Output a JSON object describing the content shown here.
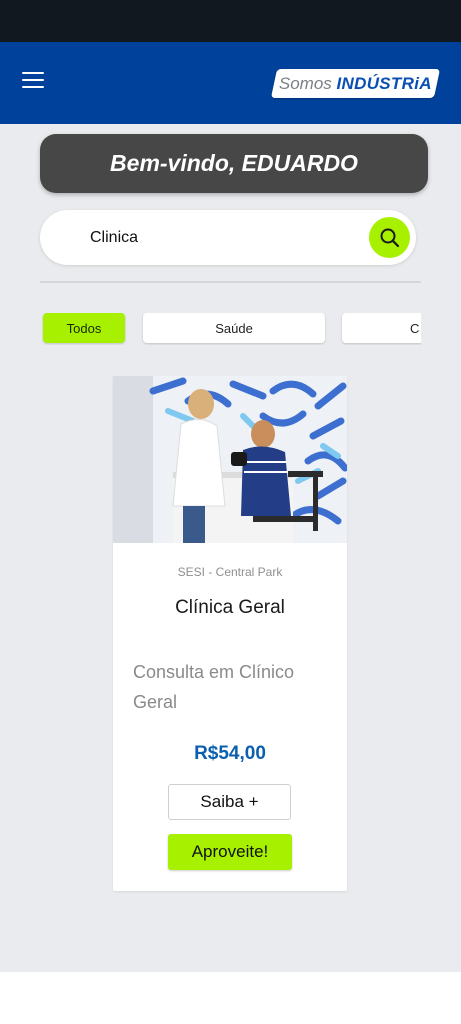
{
  "header": {
    "menu_icon": "hamburger-menu-icon",
    "logo": {
      "part1": "Somos ",
      "part2": "INDÚSTRiA"
    }
  },
  "welcome": {
    "text": "Bem-vindo, EDUARDO"
  },
  "search": {
    "value": "Clinica",
    "placeholder": "",
    "icon": "search-icon"
  },
  "filters": [
    {
      "label": "Todos",
      "active": true
    },
    {
      "label": "Saúde",
      "active": false
    },
    {
      "label": "C",
      "active": false
    }
  ],
  "card": {
    "image": "photo-nurse-measuring-blood-pressure",
    "location": "SESI - Central Park",
    "title": "Clínica Geral",
    "description": "Consulta em Clínico Geral",
    "price": "R$54,00",
    "more_button": "Saiba +",
    "cta_button": "Aproveite!"
  },
  "colors": {
    "header": "#00429b",
    "accent": "#a6f000",
    "banner": "#474747",
    "price": "#0b5fae",
    "background": "#e9ebee"
  }
}
